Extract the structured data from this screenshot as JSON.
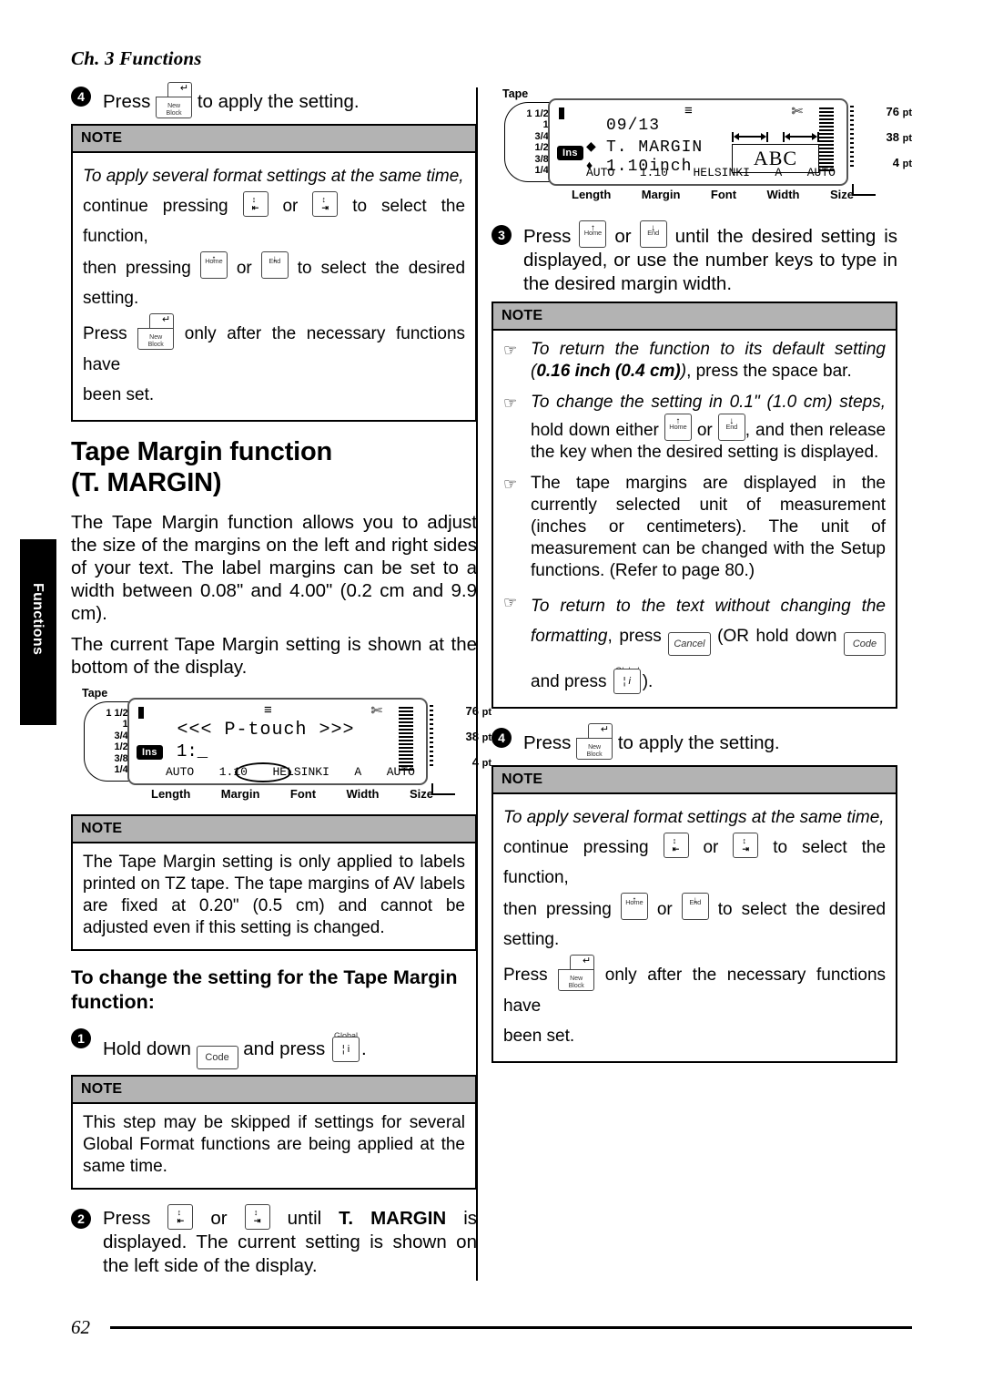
{
  "page": {
    "running_head": "Ch. 3 Functions",
    "page_number": "62",
    "side_tab_label": "Functions"
  },
  "note_label": "NOTE",
  "keys": {
    "new_block": {
      "label_top": "New",
      "label_bottom": "Block",
      "glyph": "↵",
      "name": "new-block-key"
    },
    "left_fn": {
      "glyph": "↕",
      "sub": "⇤",
      "name": "left-function-key"
    },
    "right_fn": {
      "glyph": "↕",
      "sub": "⇥",
      "name": "right-function-key"
    },
    "home": {
      "label": "Home",
      "glyph": "↑",
      "name": "home-key"
    },
    "end": {
      "label": "End",
      "glyph": "↓",
      "name": "end-key"
    },
    "code": {
      "label": "Code",
      "name": "code-key"
    },
    "cancel": {
      "label": "Cancel",
      "name": "cancel-key"
    },
    "global": {
      "caption": "Global",
      "glyph_left": "¦",
      "glyph_right": "i",
      "name": "global-key"
    }
  },
  "left_column": {
    "step4": {
      "number": "4",
      "text_before": "Press",
      "text_after": "to apply the setting."
    },
    "note_apply": {
      "line1": "To apply several format settings at the same time,",
      "line2_a": "continue pressing",
      "line2_b": "or",
      "line2_c": "to select the function,",
      "line3_a": "then pressing",
      "line3_b": "or",
      "line3_c": "to select the desired setting.",
      "line4_a": "Press",
      "line4_b": "only after the necessary functions have",
      "line5": "been set."
    },
    "heading_line1": "Tape Margin function",
    "heading_line2": "(T. MARGIN)",
    "para1": "The Tape Margin function allows you to adjust the size of the margins on the left and right sides of your text. The label margins can be set to a width between 0.08\" and 4.00\" (0.2 cm and 9.9 cm).",
    "para2": "The current Tape Margin setting is shown at the bottom of the display.",
    "note_tz": {
      "text": "The Tape Margin setting is only applied to labels printed on TZ tape. The tape margins of AV labels are fixed at 0.20\" (0.5 cm) and cannot be adjusted even if this setting is changed."
    },
    "subheading": "To change the setting for the Tape Margin function:",
    "step1": {
      "number": "1",
      "text_before": "Hold down",
      "text_middle": "and press",
      "text_after": "."
    },
    "note_skip": {
      "text": "This step may be skipped if settings for several Global Format functions are being applied at the same time."
    },
    "step2": {
      "number": "2",
      "text_a": "Press",
      "text_b": "or",
      "text_c": "until",
      "bold": "T. MARGIN",
      "text_d": "is displayed. The current setting is shown on the left side of the display."
    }
  },
  "right_column": {
    "step3": {
      "number": "3",
      "text_a": "Press",
      "text_b": "or",
      "text_c": "until the desired setting is displayed, or use the number keys to type in the desired margin width."
    },
    "note_tips": {
      "hand_icon": "☞",
      "item1": {
        "italic_a": "To return the function to its default setting (",
        "bold_a": "0.16 inch (0.4 cm)",
        "italic_b": ")",
        "roman": ", press the space bar."
      },
      "item2": {
        "italic_a": "To change the setting in 0.1\" (1.0 cm) steps,",
        "roman_a": "hold down either",
        "roman_b": "or",
        "roman_c": ", and then release the key when the desired setting is displayed."
      },
      "item3": {
        "text": "The tape margins are displayed in the currently selected unit of measurement (inches or centimeters). The unit of measurement can be changed with the Setup functions. (Refer to page 80.)"
      },
      "item4": {
        "italic_a": "To return to the text without changing the formatting",
        "roman_a": ", press",
        "roman_b": "(OR hold down",
        "roman_c": "and press",
        "roman_d": ")."
      }
    },
    "step4": {
      "number": "4",
      "text_before": "Press",
      "text_after": "to apply the setting."
    },
    "note_apply": {
      "line1": "To apply several format settings at the same time,",
      "line2_a": "continue pressing",
      "line2_b": "or",
      "line2_c": "to select the function,",
      "line3_a": "then pressing",
      "line3_b": "or",
      "line3_c": "to select the desired setting.",
      "line4_a": "Press",
      "line4_b": "only after the necessary functions have",
      "line5": "been set."
    }
  },
  "lcd_common": {
    "tape_title": "Tape",
    "tape_sizes": [
      "1 1/2\"",
      "1\"",
      "3/4\"",
      "1/2\"",
      "3/8\"",
      "1/4\""
    ],
    "size_scale": [
      "76",
      "38",
      "4"
    ],
    "size_unit": "pt",
    "ins_badge": "Ins",
    "scissors_icon": "✄",
    "align_icon": "≡",
    "bottom_labels": [
      "Length",
      "Margin",
      "Font",
      "Width",
      "Size"
    ],
    "status": {
      "length": "AUTO",
      "margin": "1.10",
      "font": "HELSINKI",
      "width": "A",
      "size": "AUTO"
    }
  },
  "lcd_left": {
    "main_text": "<<< P-touch >>>",
    "line_number": "1:_"
  },
  "lcd_right": {
    "date": "09/13",
    "function_name": "T. MARGIN",
    "value": "1.10inch",
    "preview_text": "ABC",
    "h_arrow": "◆",
    "v_arrow": "♦"
  }
}
